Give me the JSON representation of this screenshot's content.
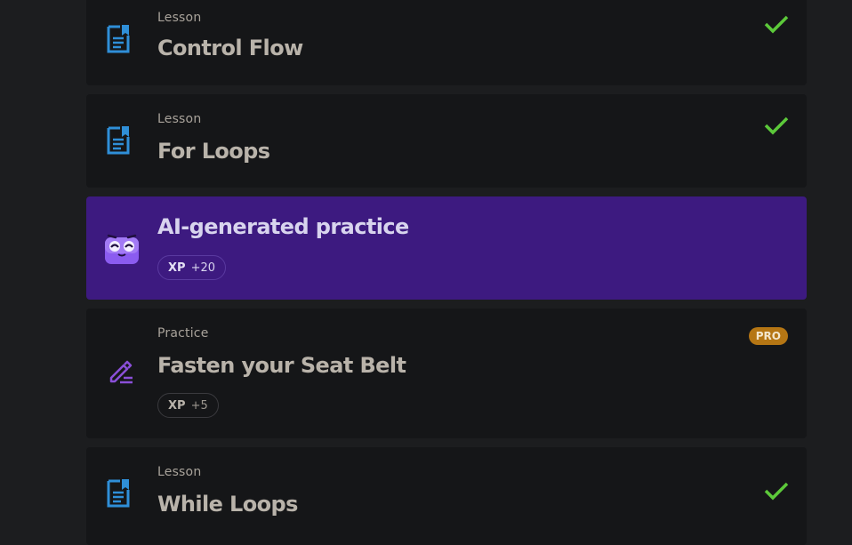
{
  "items": [
    {
      "kind": "lesson",
      "kicker": "Lesson",
      "title": "Control Flow",
      "status": "completed",
      "icon": "lesson-document-icon"
    },
    {
      "kind": "lesson",
      "kicker": "Lesson",
      "title": "For Loops",
      "status": "completed",
      "icon": "lesson-document-icon"
    },
    {
      "kind": "ai-practice",
      "title": "AI-generated practice",
      "xp_label": "XP",
      "xp_value": "+20",
      "icon": "ai-mascot-icon"
    },
    {
      "kind": "practice",
      "kicker": "Practice",
      "title": "Fasten your Seat Belt",
      "badge": "PRO",
      "xp_label": "XP",
      "xp_value": "+5",
      "icon": "practice-pencil-icon"
    },
    {
      "kind": "lesson",
      "kicker": "Lesson",
      "title": "While Loops",
      "status": "completed",
      "icon": "lesson-document-icon"
    }
  ],
  "colors": {
    "page_background": "#1c1d1f",
    "card_background": "#151618",
    "ai_card_background": "#3d1a80",
    "lesson_icon": "#2f8fd8",
    "practice_icon": "#8a4fd8",
    "check": "#5cc93a",
    "pro_badge": "#b57614"
  }
}
